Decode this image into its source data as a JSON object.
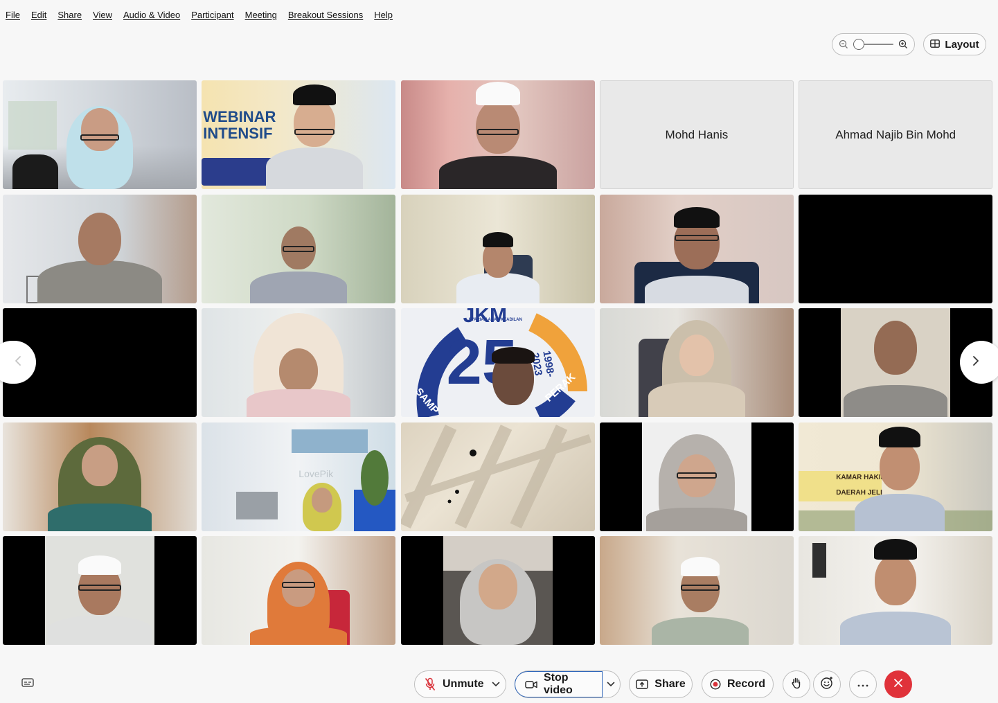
{
  "menu": [
    "File",
    "Edit",
    "Share",
    "View",
    "Audio & Video",
    "Participant",
    "Meeting",
    "Breakout Sessions",
    "Help"
  ],
  "top_controls": {
    "zoom_level": 0.0,
    "layout_label": "Layout"
  },
  "participants": [
    {
      "type": "video",
      "scene": "office-hijab-light"
    },
    {
      "type": "video",
      "scene": "poster-webinar",
      "poster_lines": [
        "WEBINAR",
        "INTENSIF"
      ]
    },
    {
      "type": "video",
      "scene": "curtain-cap-white"
    },
    {
      "type": "name",
      "name": "Mohd Hanis"
    },
    {
      "type": "name",
      "name": "Ahmad Najib Bin Mohd"
    },
    {
      "type": "video",
      "scene": "office-man-grey"
    },
    {
      "type": "video",
      "scene": "office-man-glasses"
    },
    {
      "type": "video",
      "scene": "room-cap-black"
    },
    {
      "type": "video",
      "scene": "office-cap-black-glasses"
    },
    {
      "type": "black"
    },
    {
      "type": "black"
    },
    {
      "type": "video",
      "scene": "office-hijab-cream"
    },
    {
      "type": "video",
      "scene": "logo-25",
      "poster_lines": [
        "JKM",
        "25",
        "SYARIAH ASAS KEADILAN",
        "1998-2023",
        "SAMP",
        "PERAK"
      ]
    },
    {
      "type": "video",
      "scene": "office-hijab-beige"
    },
    {
      "type": "video",
      "scene": "bars-man-smile"
    },
    {
      "type": "video",
      "scene": "room-hijab-green"
    },
    {
      "type": "video",
      "scene": "office-hijab-small",
      "watermark": "LovePik"
    },
    {
      "type": "video",
      "scene": "wall-shadow"
    },
    {
      "type": "video",
      "scene": "bars-hijab-grey-glasses"
    },
    {
      "type": "video",
      "scene": "poster-kamar-hakim",
      "poster_lines": [
        "KAMAR HAKIM",
        "DAERAH JELI"
      ]
    },
    {
      "type": "video",
      "scene": "bars-man-cap-white"
    },
    {
      "type": "video",
      "scene": "office-hijab-orange"
    },
    {
      "type": "video",
      "scene": "car-hijab-grey"
    },
    {
      "type": "video",
      "scene": "office-cap-white-glasses"
    },
    {
      "type": "video",
      "scene": "room-cap-black-smile"
    }
  ],
  "toolbar": {
    "unmute_label": "Unmute",
    "stop_video_label": "Stop video",
    "share_label": "Share",
    "record_label": "Record"
  },
  "colors": {
    "leave": "#e0323a",
    "mute_red": "#d9323a"
  }
}
